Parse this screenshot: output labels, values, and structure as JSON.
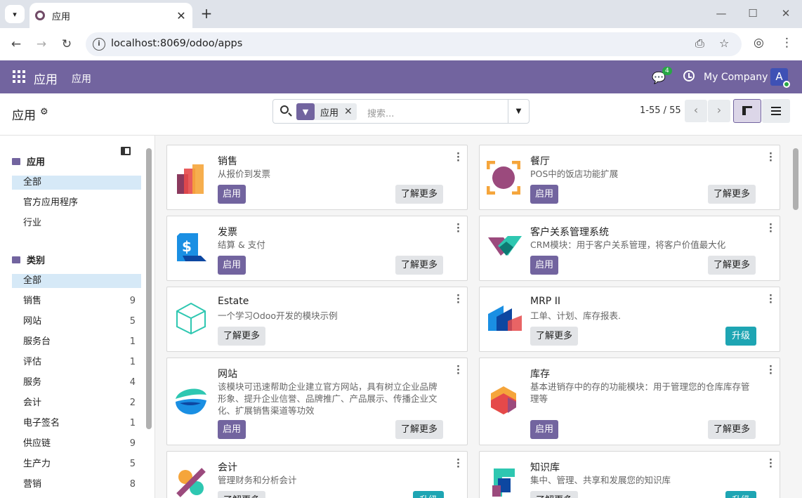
{
  "browser": {
    "tab_title": "应用",
    "url": "localhost:8069/odoo/apps"
  },
  "navbar": {
    "brand": "应用",
    "menu_item": "应用",
    "chat_count": "4",
    "company": "My Company",
    "avatar_letter": "A"
  },
  "control": {
    "title": "应用",
    "facet_label": "应用",
    "search_placeholder": "搜索...",
    "pager": "1-55 / 55"
  },
  "sidebar": {
    "apps_header": "应用",
    "apps_items": [
      {
        "label": "全部",
        "selected": true
      },
      {
        "label": "官方应用程序"
      },
      {
        "label": "行业"
      }
    ],
    "categories_header": "类别",
    "categories": [
      {
        "label": "全部",
        "count": "",
        "selected": true
      },
      {
        "label": "销售",
        "count": "9"
      },
      {
        "label": "网站",
        "count": "5"
      },
      {
        "label": "服务台",
        "count": "1"
      },
      {
        "label": "评估",
        "count": "1"
      },
      {
        "label": "服务",
        "count": "4"
      },
      {
        "label": "会计",
        "count": "2"
      },
      {
        "label": "电子签名",
        "count": "1"
      },
      {
        "label": "供应链",
        "count": "9"
      },
      {
        "label": "生产力",
        "count": "5"
      },
      {
        "label": "营销",
        "count": "8"
      }
    ]
  },
  "buttons": {
    "activate": "启用",
    "learn_more": "了解更多",
    "upgrade": "升级"
  },
  "apps": [
    {
      "name": "销售",
      "desc": "从报价到发票"
    },
    {
      "name": "餐厅",
      "desc": "POS中的饭店功能扩展"
    },
    {
      "name": "发票",
      "desc": "结算 & 支付"
    },
    {
      "name": "客户关系管理系统",
      "desc": "CRM模块：用于客户关系管理，将客户价值最大化"
    },
    {
      "name": "Estate",
      "desc": "一个学习Odoo开发的模块示例"
    },
    {
      "name": "MRP II",
      "desc": "工单、计划、库存报表."
    },
    {
      "name": "网站",
      "desc": "该模块可迅速帮助企业建立官方网站，具有树立企业品牌形象、提升企业信誉、品牌推广、产品展示、传播企业文化、扩展销售渠道等功效"
    },
    {
      "name": "库存",
      "desc": "基本进销存中的存的功能模块：用于管理您的仓库库存管理等"
    },
    {
      "name": "会计",
      "desc": "管理财务和分析会计"
    },
    {
      "name": "知识库",
      "desc": "集中、管理、共享和发展您的知识库"
    }
  ],
  "colors": {
    "brand": "#72649f",
    "upgrade": "#1ea5b3",
    "selected": "#d6e9f7"
  }
}
